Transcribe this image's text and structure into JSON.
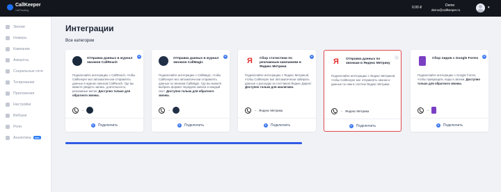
{
  "app": {
    "logo_text": "CallKeeper",
    "logo_sub": "CallTracking",
    "balance": "0.00 ₽",
    "user_name": "Demo",
    "user_email": "demo@callkeeper.ru"
  },
  "sidebar": {
    "items": [
      {
        "label": "Звонки",
        "icon": "phone-icon"
      },
      {
        "label": "Номера",
        "icon": "number-icon"
      },
      {
        "label": "Кампании",
        "icon": "campaign-icon"
      },
      {
        "label": "Аккаунты",
        "icon": "account-icon"
      },
      {
        "label": "Социальные сети",
        "icon": "social-icon"
      },
      {
        "label": "Тегирование",
        "icon": "tag-icon"
      },
      {
        "label": "Приложения",
        "icon": "apps-icon"
      },
      {
        "label": "Настройки",
        "icon": "gear-icon"
      },
      {
        "label": "Вебхуки",
        "icon": "webhook-icon"
      },
      {
        "label": "Роли",
        "icon": "roles-icon"
      },
      {
        "label": "Аналитика",
        "icon": "analytics-icon",
        "badge": "beta"
      }
    ]
  },
  "main": {
    "title": "Интеграции",
    "section": "Все категории",
    "cards": [
      {
        "title": "Отправка данных в журнал звонков CallReach",
        "desc": "Подключайте интеграцию с CallReach, чтобы CallKeeper мог автоматически отправлять данные в журнал звонков CallReach. Где вы можете увидеть запись, длительность, рекламные метки.",
        "note": "Доступно только для обратного звонка.",
        "connect": "Подключить",
        "logo_color": "#1a2a3c",
        "badge": "+"
      },
      {
        "title": "Отправка данных в журнал звонков CallMagic",
        "desc": "Подключайте интеграцию с CallMagic, чтобы CallKeeper мог автоматически отправлять данные по звонкам CallMagic. Где вы можете выбрать формат передачи записи и каждый лист.",
        "note": "Доступно только для обратного звонка.",
        "connect": "Подключить",
        "logo_color": "#223047",
        "badge": "+"
      },
      {
        "title": "Сбор статистики по рекламным кампаниям в Яндекс Метрики",
        "desc": "Подключайте интеграцию с Яндекс Метрикой, чтобы CallKeeper мог автоматически забирать данные о расходах из счетчиков Яндекс Директ",
        "note": "Доступно только для аналитики.",
        "connect": "Подключить",
        "logo_color": "#ffffff",
        "target": "Яндекс Метрика",
        "badge": "+"
      },
      {
        "title": "Отправка данных по звонкам в Яндекс Метрику",
        "desc": "Подключайте интеграцию с Яндекс Метрикой, чтобы CallKeeper мог отправлять звонки и данные по ним в счетчик Яндекс Метрики.",
        "note": "",
        "connect": "Подключить",
        "logo_color": "#ffffff",
        "target": "Яндекс Метрика",
        "badge": "+"
      },
      {
        "title": "Сбор лидов с Google Forms",
        "desc": "Подключайте интеграцию с Google Forms, чтобы превращать лиды в звонки.",
        "note": "Доступно только для обратного звонка.",
        "connect": "Подключить",
        "logo_color": "#7b3fc4",
        "badge": "+"
      }
    ]
  },
  "colors": {
    "accent": "#3e78f0",
    "selected_border": "#e0484d",
    "topbar": "#13161c",
    "progress": "#2f5be6"
  }
}
